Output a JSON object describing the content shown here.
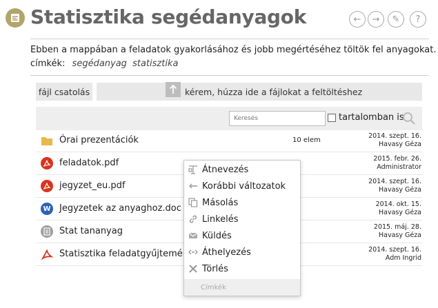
{
  "page": {
    "title": "Statisztika segédanyagok",
    "description": "Ebben a mappában a feladatok gyakorlásához és jobb megértéséhez töltök fel anyagokat.",
    "tags_label": "címkék:",
    "tags": [
      "segédanyag",
      "statisztika"
    ]
  },
  "header_buttons": {
    "back": "←",
    "forward": "→",
    "edit": "✎",
    "help": "?"
  },
  "upload": {
    "attach_label": "fájl csatolás",
    "dropzone_label": "kérem, húzza ide a fájlokat a feltöltéshez"
  },
  "search": {
    "placeholder": "Keresés",
    "in_content_label": "tartalomban is"
  },
  "files": [
    {
      "name": "Órai prezentációk",
      "count": "10 elem",
      "date": "2014. szept. 16.",
      "owner": "Havasy Géza",
      "icon": "folder-icon"
    },
    {
      "name": "feladatok.pdf",
      "count": "",
      "date": "2015. febr. 26.",
      "owner": "Administrator",
      "icon": "pdf-icon"
    },
    {
      "name": "jegyzet_eu.pdf",
      "count": "",
      "date": "2014. szept. 16.",
      "owner": "Havasy Géza",
      "icon": "pdf-icon"
    },
    {
      "name": "Jegyzetek az anyaghoz.doc",
      "count": "",
      "date": "2014. okt. 15.",
      "owner": "Havasy Géza",
      "icon": "word-icon"
    },
    {
      "name": "Stat tananyag",
      "count": "",
      "date": "2015. máj. 28.",
      "owner": "Havasy Géza",
      "icon": "document-icon"
    },
    {
      "name": "Statisztika feladatgyűjtemény.",
      "count": "",
      "date": "2014. szept. 16.",
      "owner": "Adm Ingrid",
      "icon": "pdf-icon"
    }
  ],
  "context_menu": {
    "items": [
      {
        "label": "Átnevezés",
        "icon": "rename-icon"
      },
      {
        "label": "Korábbi változatok",
        "icon": "history-icon"
      },
      {
        "label": "Másolás",
        "icon": "copy-icon"
      },
      {
        "label": "Linkelés",
        "icon": "link-icon"
      },
      {
        "label": "Küldés",
        "icon": "mail-icon"
      },
      {
        "label": "Áthelyezés",
        "icon": "move-icon"
      },
      {
        "label": "Törlés",
        "icon": "delete-icon"
      },
      {
        "label": "Címkék",
        "icon": ""
      }
    ]
  },
  "colors": {
    "accent_icon": "#b1a56a",
    "pdf": "#d9341e",
    "word": "#2a63b8",
    "folder": "#e8b84a"
  }
}
